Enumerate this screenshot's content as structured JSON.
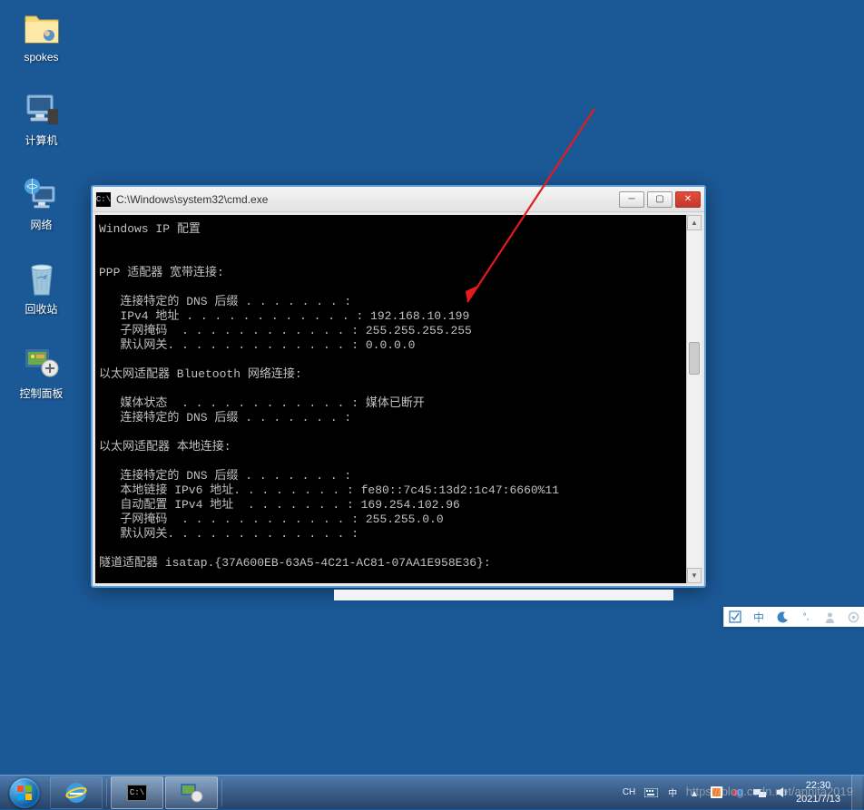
{
  "desktop_icons": [
    {
      "name": "spokes"
    },
    {
      "name": "计算机"
    },
    {
      "name": "网络"
    },
    {
      "name": "回收站"
    },
    {
      "name": "控制面板"
    }
  ],
  "cmd_window": {
    "title": "C:\\Windows\\system32\\cmd.exe",
    "content": "Windows IP 配置\n\n\nPPP 适配器 宽带连接:\n\n   连接特定的 DNS 后缀 . . . . . . . :\n   IPv4 地址 . . . . . . . . . . . . : 192.168.10.199\n   子网掩码  . . . . . . . . . . . . : 255.255.255.255\n   默认网关. . . . . . . . . . . . . : 0.0.0.0\n\n以太网适配器 Bluetooth 网络连接:\n\n   媒体状态  . . . . . . . . . . . . : 媒体已断开\n   连接特定的 DNS 后缀 . . . . . . . :\n\n以太网适配器 本地连接:\n\n   连接特定的 DNS 后缀 . . . . . . . :\n   本地链接 IPv6 地址. . . . . . . . : fe80::7c45:13d2:1c47:6660%11\n   自动配置 IPv4 地址  . . . . . . . : 169.254.102.96\n   子网掩码  . . . . . . . . . . . . : 255.255.0.0\n   默认网关. . . . . . . . . . . . . :\n\n隧道适配器 isatap.{37A600EB-63A5-4C21-AC81-07AA1E958E36}:"
  },
  "taskbar": {
    "ime_lang": "CH",
    "ime_input": "中",
    "time": "22:30",
    "date": "2021/7/13"
  },
  "watermark": "https://blog.csdn.net/annita2019",
  "side_toolbar_ime": "中",
  "colors": {
    "desktop_bg": "#1b5896",
    "arrow": "#e31b1b"
  }
}
